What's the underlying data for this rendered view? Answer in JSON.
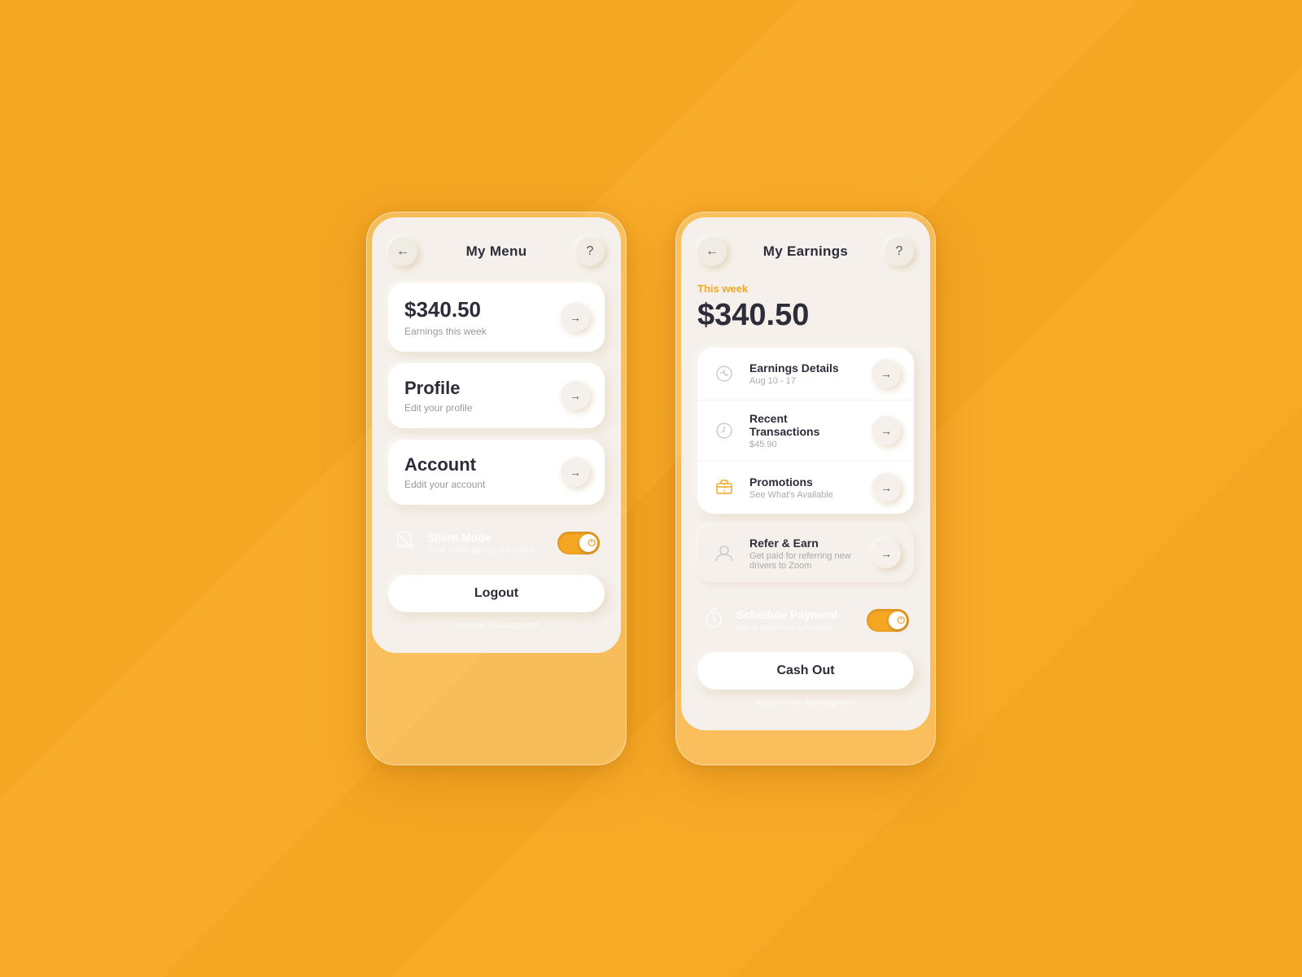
{
  "background": {
    "color": "#F5A623"
  },
  "leftPhone": {
    "header": {
      "title": "My Menu",
      "backBtn": "←",
      "helpBtn": "?"
    },
    "earningsCard": {
      "amount": "$340.50",
      "subtitle": "Earnings this week"
    },
    "profileCard": {
      "title": "Profile",
      "subtitle": "Edit your profile"
    },
    "accountCard": {
      "title": "Account",
      "subtitle": "Eddit your account"
    },
    "silentMode": {
      "label": "Silent Mode",
      "subtitle": "Your notifications are silent.",
      "iconUnicode": "🔕"
    },
    "logoutBtn": "Logout",
    "caption": "Income Managment"
  },
  "rightPhone": {
    "header": {
      "title": "My Earnings",
      "backBtn": "←",
      "helpBtn": "?"
    },
    "weekLabel": "This week",
    "earningsAmount": "$340.50",
    "listItems": [
      {
        "title": "Earnings Details",
        "subtitle": "Aug 10 - 17",
        "iconType": "chart"
      },
      {
        "title": "Recent Transactions",
        "subtitle": "$45.90",
        "iconType": "clock"
      },
      {
        "title": "Promotions",
        "subtitle": "See What's Available",
        "iconType": "ticket",
        "iconColor": "orange"
      }
    ],
    "referCard": {
      "title": "Refer & Earn",
      "subtitle": "Get paid for referring new drivers to Zoom",
      "iconType": "person"
    },
    "schedulePayment": {
      "label": "Schedule Payment",
      "subtitle": "Set a payment schedule",
      "iconUnicode": "⏰"
    },
    "cashOutBtn": "Cash Out",
    "caption": "Application Managment"
  }
}
